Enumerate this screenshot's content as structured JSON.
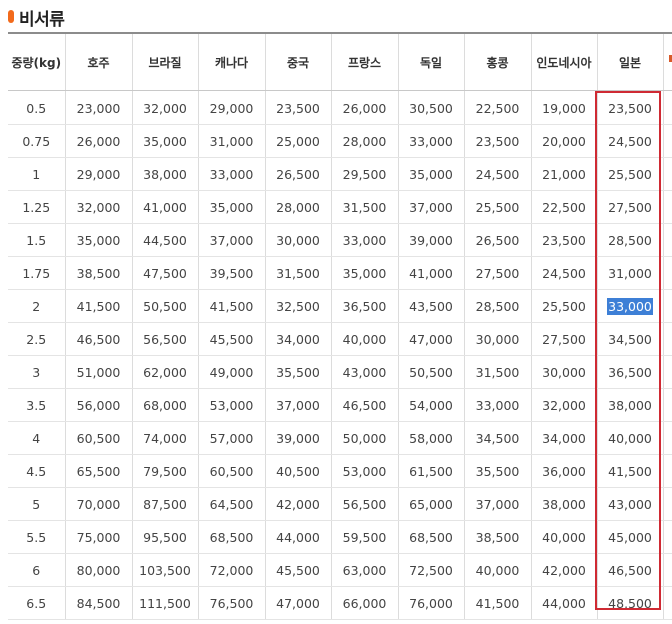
{
  "title": "비서류",
  "table": {
    "headers": [
      "중량(kg)",
      "호주",
      "브라질",
      "캐나다",
      "중국",
      "프랑스",
      "독일",
      "홍콩",
      "인도네시아",
      "일본"
    ],
    "rows": [
      [
        "0.5",
        "23,000",
        "32,000",
        "29,000",
        "23,500",
        "26,000",
        "30,500",
        "22,500",
        "19,000",
        "23,500"
      ],
      [
        "0.75",
        "26,000",
        "35,000",
        "31,000",
        "25,000",
        "28,000",
        "33,000",
        "23,500",
        "20,000",
        "24,500"
      ],
      [
        "1",
        "29,000",
        "38,000",
        "33,000",
        "26,500",
        "29,500",
        "35,000",
        "24,500",
        "21,000",
        "25,500"
      ],
      [
        "1.25",
        "32,000",
        "41,000",
        "35,000",
        "28,000",
        "31,500",
        "37,000",
        "25,500",
        "22,500",
        "27,500"
      ],
      [
        "1.5",
        "35,000",
        "44,500",
        "37,000",
        "30,000",
        "33,000",
        "39,000",
        "26,500",
        "23,500",
        "28,500"
      ],
      [
        "1.75",
        "38,500",
        "47,500",
        "39,500",
        "31,500",
        "35,000",
        "41,000",
        "27,500",
        "24,500",
        "31,000"
      ],
      [
        "2",
        "41,500",
        "50,500",
        "41,500",
        "32,500",
        "36,500",
        "43,500",
        "28,500",
        "25,500",
        "33,000"
      ],
      [
        "2.5",
        "46,500",
        "56,500",
        "45,500",
        "34,000",
        "40,000",
        "47,000",
        "30,000",
        "27,500",
        "34,500"
      ],
      [
        "3",
        "51,000",
        "62,000",
        "49,000",
        "35,500",
        "43,000",
        "50,500",
        "31,500",
        "30,000",
        "36,500"
      ],
      [
        "3.5",
        "56,000",
        "68,000",
        "53,000",
        "37,000",
        "46,500",
        "54,000",
        "33,000",
        "32,000",
        "38,000"
      ],
      [
        "4",
        "60,500",
        "74,000",
        "57,000",
        "39,000",
        "50,000",
        "58,000",
        "34,500",
        "34,000",
        "40,000"
      ],
      [
        "4.5",
        "65,500",
        "79,500",
        "60,500",
        "40,500",
        "53,000",
        "61,500",
        "35,500",
        "36,000",
        "41,500"
      ],
      [
        "5",
        "70,000",
        "87,500",
        "64,500",
        "42,000",
        "56,500",
        "65,000",
        "37,000",
        "38,000",
        "43,000"
      ],
      [
        "5.5",
        "75,000",
        "95,500",
        "68,500",
        "44,000",
        "59,500",
        "68,500",
        "38,500",
        "40,000",
        "45,000"
      ],
      [
        "6",
        "80,000",
        "103,500",
        "72,000",
        "45,500",
        "63,000",
        "72,500",
        "40,000",
        "42,000",
        "46,500"
      ],
      [
        "6.5",
        "84,500",
        "111,500",
        "76,500",
        "47,000",
        "66,000",
        "76,000",
        "41,500",
        "44,000",
        "48,500"
      ]
    ],
    "highlighted_column": "일본",
    "selected_cell": {
      "row": 6,
      "column": 9,
      "value": "33,000"
    }
  },
  "colors": {
    "title_bullet": "#f26a1b",
    "highlight_border": "#cf2a33",
    "selection_background": "#3d7fd6",
    "header_rule": "#8c8c8c"
  }
}
